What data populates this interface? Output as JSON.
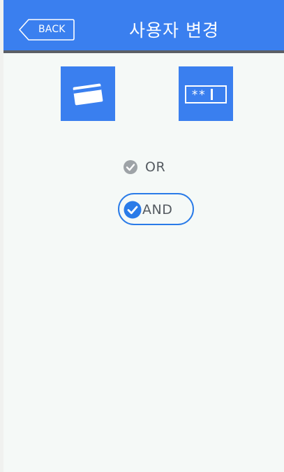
{
  "header": {
    "back_label": "BACK",
    "title": "사용자 변경"
  },
  "auth_modes": [
    {
      "icon": "card-icon"
    },
    {
      "icon": "pin-icon",
      "text": "**"
    }
  ],
  "options": [
    {
      "label": "OR",
      "selected": false
    },
    {
      "label": "AND",
      "selected": true
    }
  ],
  "colors": {
    "primary": "#3a7fef",
    "header_border": "#5b5f66",
    "background": "#f5f9f7",
    "check_selected": "#2a7be8",
    "check_unselected": "#9ea3a7",
    "label_text": "#555b61"
  }
}
